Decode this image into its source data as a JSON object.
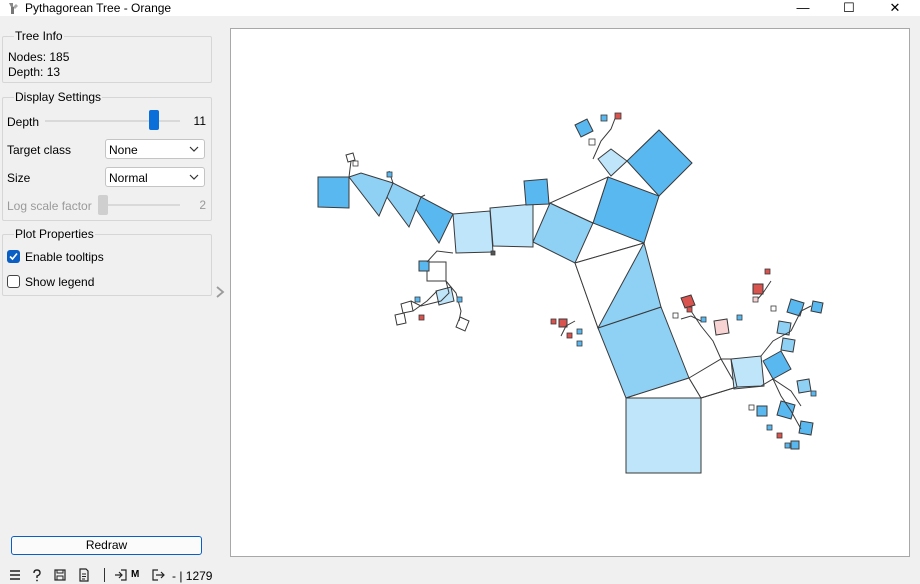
{
  "window": {
    "title": "Pythagorean Tree - Orange",
    "minimize_glyph": "—",
    "maximize_glyph": "☐",
    "close_glyph": "✕"
  },
  "tree_info": {
    "title": "Tree Info",
    "nodes_text": "Nodes: 185",
    "depth_text": "Depth: 13"
  },
  "display_settings": {
    "title": "Display Settings",
    "depth_label": "Depth",
    "depth_value": "11",
    "depth_fraction": 0.83,
    "target_class_label": "Target class",
    "target_class_value": "None",
    "size_label": "Size",
    "size_value": "Normal",
    "log_scale_label": "Log scale factor",
    "log_scale_value": "2",
    "log_scale_fraction": 0.0
  },
  "plot_properties": {
    "title": "Plot Properties",
    "enable_tooltips_label": "Enable tooltips",
    "enable_tooltips_checked": true,
    "show_legend_label": "Show legend",
    "show_legend_checked": false
  },
  "redraw_label": "Redraw",
  "status_bar": {
    "icons": [
      "menu-icon",
      "help-icon",
      "save-icon",
      "report-icon",
      "input-icon",
      "output-icon"
    ],
    "input_marker": "M",
    "text": "- | 1279"
  },
  "colors": {
    "accent": "#0a6fd8",
    "blue_dark": "#5ab8f0",
    "blue_mid": "#8fd0f5",
    "blue_light": "#bfe5fb",
    "red": "#d9534f",
    "pink": "#f7d3d3"
  }
}
